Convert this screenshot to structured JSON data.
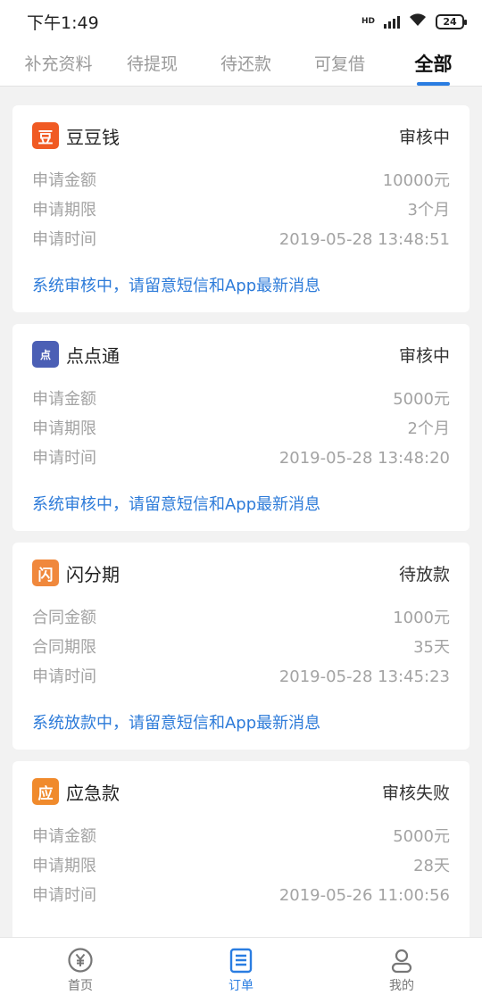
{
  "status_bar": {
    "time": "下午1:49",
    "network": "HD",
    "battery": "24"
  },
  "tabs": [
    {
      "label": "补充资料"
    },
    {
      "label": "待提现"
    },
    {
      "label": "待还款"
    },
    {
      "label": "可复借"
    },
    {
      "label": "全部"
    }
  ],
  "orders": [
    {
      "name": "豆豆钱",
      "logo": "豆",
      "status": "审核中",
      "rows": [
        {
          "label": "申请金额",
          "value": "10000元"
        },
        {
          "label": "申请期限",
          "value": "3个月"
        },
        {
          "label": "申请时间",
          "value": "2019-05-28 13:48:51"
        }
      ],
      "notice": "系统审核中，请留意短信和App最新消息"
    },
    {
      "name": "点点通",
      "logo": "点",
      "status": "审核中",
      "rows": [
        {
          "label": "申请金额",
          "value": "5000元"
        },
        {
          "label": "申请期限",
          "value": "2个月"
        },
        {
          "label": "申请时间",
          "value": "2019-05-28 13:48:20"
        }
      ],
      "notice": "系统审核中，请留意短信和App最新消息"
    },
    {
      "name": "闪分期",
      "logo": "闪",
      "status": "待放款",
      "rows": [
        {
          "label": "合同金额",
          "value": "1000元"
        },
        {
          "label": "合同期限",
          "value": "35天"
        },
        {
          "label": "申请时间",
          "value": "2019-05-28 13:45:23"
        }
      ],
      "notice": "系统放款中，请留意短信和App最新消息"
    },
    {
      "name": "应急款",
      "logo": "应",
      "status": "审核失败",
      "rows": [
        {
          "label": "申请金额",
          "value": "5000元"
        },
        {
          "label": "申请期限",
          "value": "28天"
        },
        {
          "label": "申请时间",
          "value": "2019-05-26 11:00:56"
        }
      ],
      "notice": ""
    }
  ],
  "nav": [
    {
      "label": "首页",
      "icon": "yuan-icon"
    },
    {
      "label": "订单",
      "icon": "order-list-icon"
    },
    {
      "label": "我的",
      "icon": "user-icon"
    }
  ],
  "colors": {
    "accent": "#2a7de1",
    "notice": "#2d7bd9",
    "background": "#f2f2f2"
  }
}
